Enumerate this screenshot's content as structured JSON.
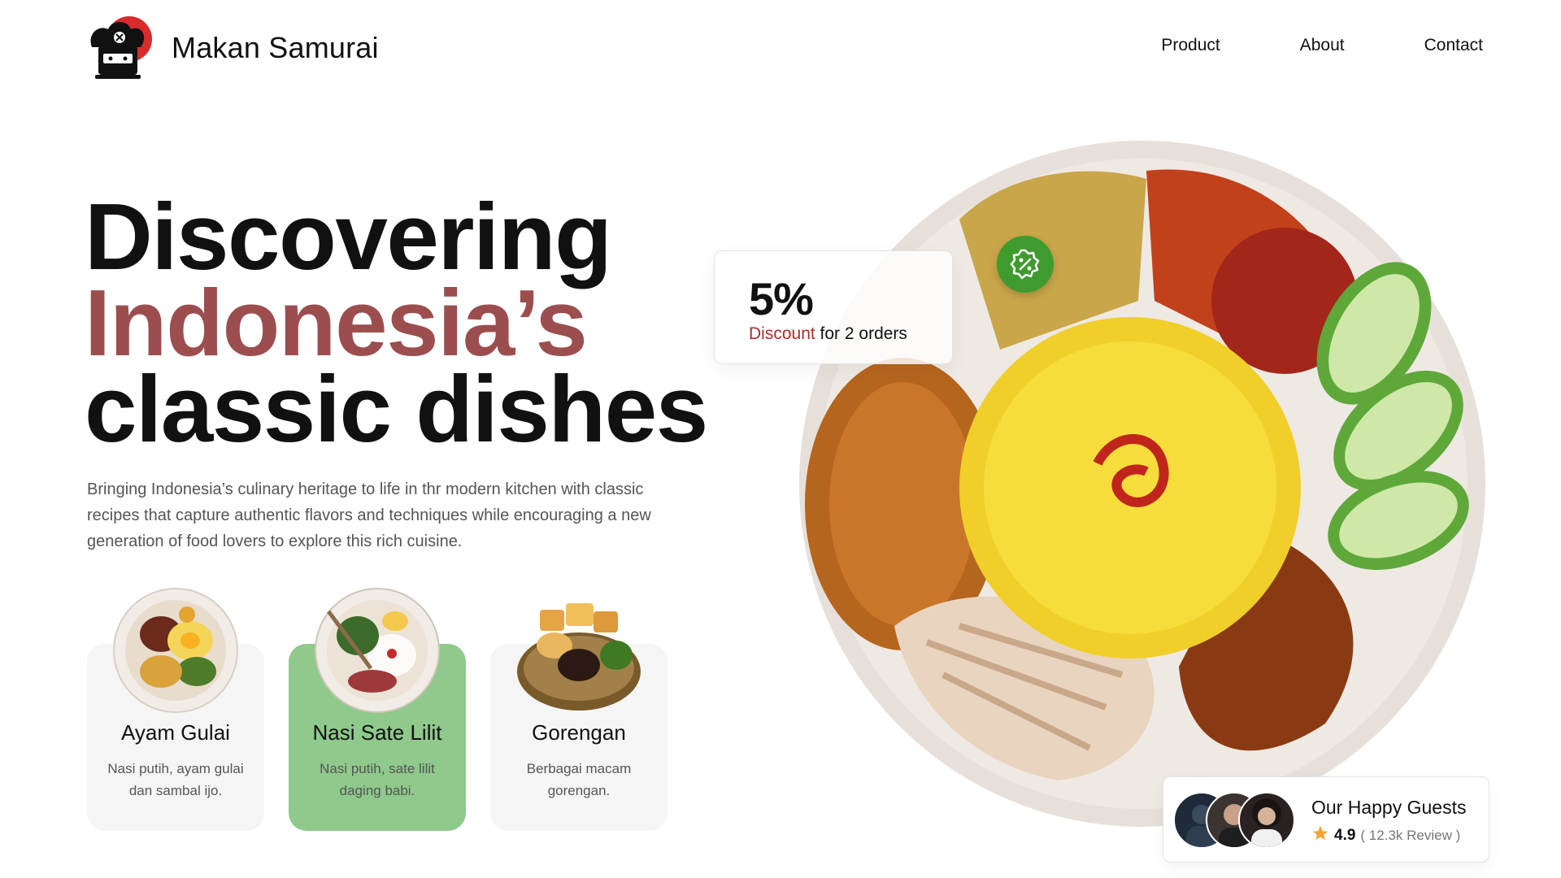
{
  "brand": {
    "name": "Makan Samurai"
  },
  "nav": {
    "items": [
      "Product",
      "About",
      "Contact"
    ]
  },
  "hero": {
    "line1": "Discovering",
    "line2": "Indonesia’s",
    "line3": "classic dishes",
    "subtitle": "Bringing Indonesia’s culinary heritage to life in thr modern kitchen with classic recipes that capture authentic flavors and techniques while encouraging a new generation of food lovers to explore this rich cuisine."
  },
  "dishes": [
    {
      "title": "Ayam Gulai",
      "desc": "Nasi putih, ayam gulai dan sambal ijo.",
      "selected": false
    },
    {
      "title": "Nasi Sate Lilit",
      "desc": "Nasi putih, sate lilit daging babi.",
      "selected": true
    },
    {
      "title": "Gorengan",
      "desc": "Berbagai macam gorengan.",
      "selected": false
    }
  ],
  "promo": {
    "percent": "5%",
    "label_highlight": "Discount",
    "label_rest": " for 2 orders",
    "icon": "discount-badge-icon"
  },
  "reviews": {
    "title": "Our Happy Guests",
    "rating": "4.9",
    "count": "( 12.3k Review )",
    "icon": "star-icon"
  },
  "colors": {
    "accent": "#9c4e4e",
    "active_card": "#8fc98c",
    "discount_red": "#b22a2a",
    "badge_green": "#3f9b2e",
    "star": "#f2a43a",
    "logo_red": "#d92b2b"
  }
}
